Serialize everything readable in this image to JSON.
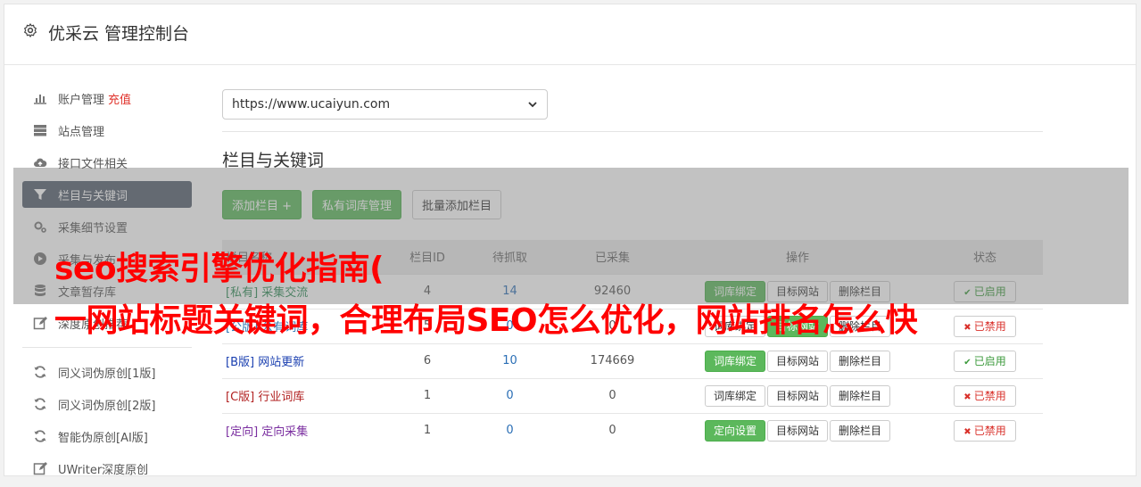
{
  "app": {
    "title": "优采云 管理控制台"
  },
  "sidebar": {
    "items": [
      {
        "label": "账户管理",
        "extra": "充值",
        "icon": "bar-chart-icon"
      },
      {
        "label": "站点管理",
        "icon": "server-icon"
      },
      {
        "label": "接口文件相关",
        "icon": "cloud-upload-icon"
      },
      {
        "label": "栏目与关键词",
        "icon": "filter-icon",
        "active": true
      },
      {
        "label": "采集细节设置",
        "icon": "cogs-icon"
      },
      {
        "label": "采集与发布",
        "icon": "play-circle-icon"
      },
      {
        "label": "文章暂存库",
        "icon": "database-icon"
      },
      {
        "label": "深度原创推荐",
        "icon": "edit-icon"
      }
    ],
    "tools": [
      {
        "label": "同义词伪原创[1版]",
        "icon": "refresh-icon"
      },
      {
        "label": "同义词伪原创[2版]",
        "icon": "refresh-icon"
      },
      {
        "label": "智能伪原创[AI版]",
        "icon": "refresh-icon"
      },
      {
        "label": "UWriter深度原创",
        "icon": "edit-icon"
      }
    ]
  },
  "main": {
    "site_select": "https://www.ucaiyun.com",
    "section_title": "栏目与关键词",
    "buttons": {
      "add_column": "添加栏目 +",
      "private_lib": "私有词库管理",
      "batch_add": "批量添加栏目"
    },
    "table": {
      "headers": [
        "栏目名称",
        "栏目ID",
        "待抓取",
        "已采集",
        "操作",
        "状态"
      ],
      "rows": [
        {
          "tag": "[私有]",
          "name": "采集交流",
          "id": "4",
          "pending": "14",
          "collected": "92460",
          "op1": "词库绑定",
          "op1_green": true,
          "op2": "目标网站",
          "op2_green": false,
          "op3": "删除栏目",
          "status": "已启用",
          "on": true,
          "cls": "pv"
        },
        {
          "tag": "[公版]",
          "name": "公有词库",
          "id": "5",
          "pending": "0",
          "collected": "0",
          "op1": "词库绑定",
          "op1_green": false,
          "op2": "目标网站",
          "op2_green": true,
          "op3": "删除栏目",
          "status": "已禁用",
          "on": false,
          "cls": "pub"
        },
        {
          "tag": "[B版]",
          "name": "网站更新",
          "id": "6",
          "pending": "10",
          "collected": "174669",
          "op1": "词库绑定",
          "op1_green": true,
          "op2": "目标网站",
          "op2_green": false,
          "op3": "删除栏目",
          "status": "已启用",
          "on": true,
          "cls": "bv"
        },
        {
          "tag": "[C版]",
          "name": "行业词库",
          "id": "1",
          "pending": "0",
          "collected": "0",
          "op1": "词库绑定",
          "op1_green": false,
          "op2": "目标网站",
          "op2_green": false,
          "op3": "删除栏目",
          "status": "已禁用",
          "on": false,
          "cls": "cv"
        },
        {
          "tag": "[定向]",
          "name": "定向采集",
          "id": "1",
          "pending": "0",
          "collected": "0",
          "op1": "定向设置",
          "op1_green": true,
          "op2": "目标网站",
          "op2_green": false,
          "op3": "删除栏目",
          "status": "已禁用",
          "on": false,
          "cls": "dx"
        }
      ]
    }
  },
  "overlay": {
    "line1": "seo搜索引擎优化指南(",
    "line2": "一网站标题关键词，合理布局SEO怎么优化，网站排名怎么快"
  }
}
